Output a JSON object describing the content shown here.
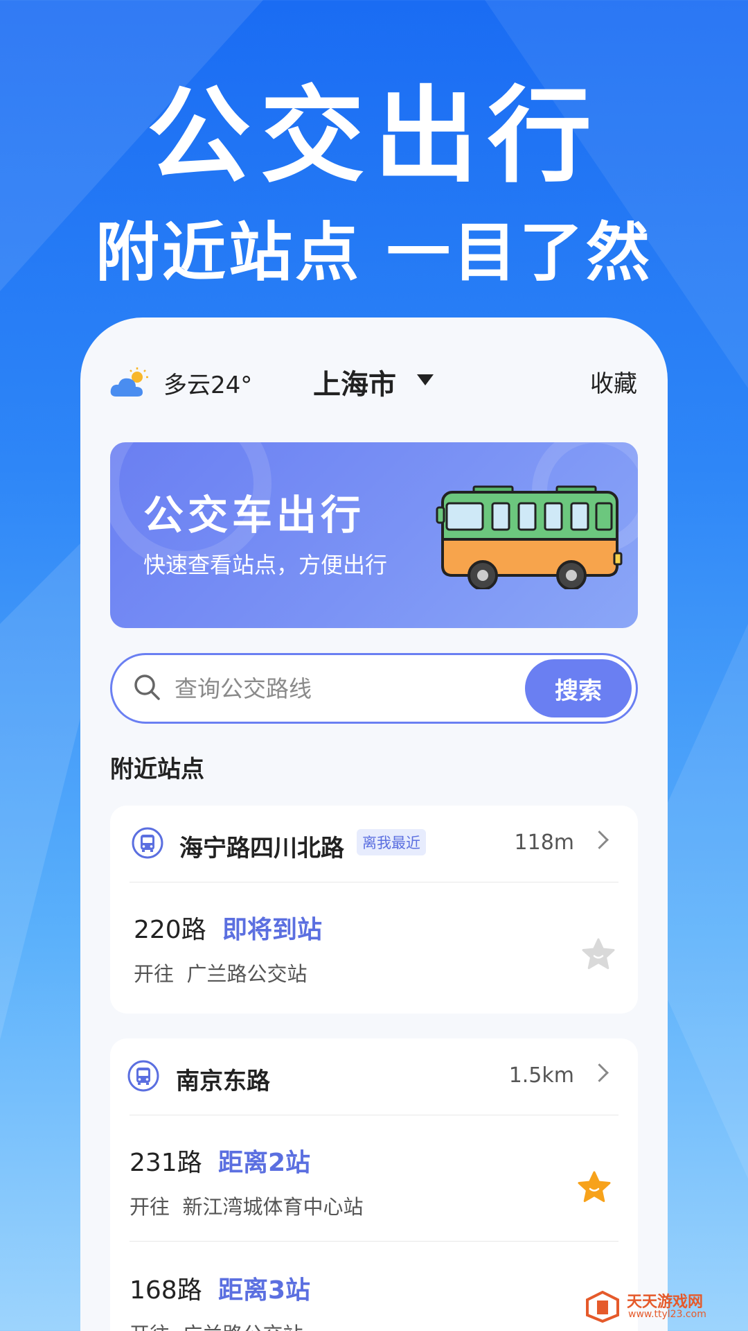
{
  "hero": {
    "title": "公交出行",
    "subtitle": "附近站点 一目了然"
  },
  "topbar": {
    "weather_icon": "partly-cloudy-icon",
    "weather": "多云24°",
    "city": "上海市",
    "favorites": "收藏"
  },
  "banner": {
    "title": "公交车出行",
    "subtitle": "快速查看站点，方便出行",
    "art": "bus-illustration"
  },
  "search": {
    "placeholder": "查询公交路线",
    "button": "搜索"
  },
  "section": {
    "title": "附近站点"
  },
  "stops": [
    {
      "name": "海宁路四川北路",
      "tag": "离我最近",
      "distance": "118m",
      "routes": [
        {
          "number": "220路",
          "status": "即将到站",
          "dest_prefix": "开往",
          "dest": "广兰路公交站",
          "favorited": false
        }
      ]
    },
    {
      "name": "南京东路",
      "tag": "",
      "distance": "1.5km",
      "routes": [
        {
          "number": "231路",
          "status": "距离2站",
          "dest_prefix": "开往",
          "dest": "新江湾城体育中心站",
          "favorited": true
        },
        {
          "number": "168路",
          "status": "距离3站",
          "dest_prefix": "开往",
          "dest": "广兰路公交站",
          "favorited": false
        }
      ]
    }
  ],
  "watermark": {
    "name": "天天游戏网",
    "url": "www.ttyl23.com"
  },
  "colors": {
    "accent": "#6a7ff2",
    "status": "#5b6fe0",
    "star_active": "#f7a21b",
    "star_inactive": "#d9d9d9"
  }
}
